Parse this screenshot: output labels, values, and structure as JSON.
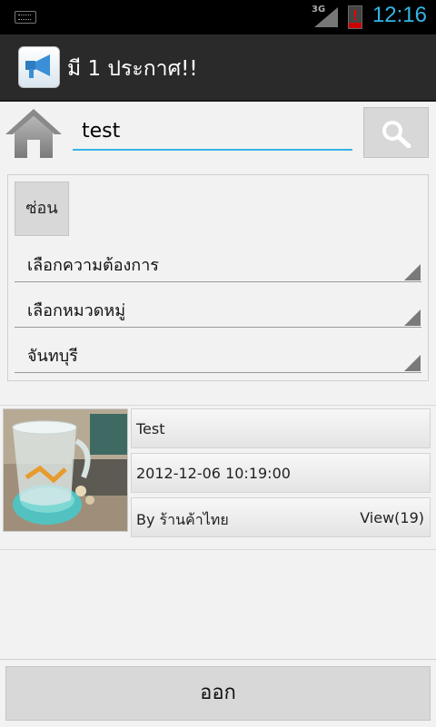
{
  "status_bar": {
    "network": "3G",
    "time": "12:16"
  },
  "title_bar": {
    "title": "มี 1 ประกาศ!!",
    "icon": "megaphone-icon"
  },
  "search": {
    "value": "test",
    "home_icon": "home-icon",
    "search_icon": "search-icon"
  },
  "filters": {
    "hide_label": "ซ่อน",
    "requirement": "เลือกความต้องการ",
    "category": "เลือกหมวดหมู่",
    "province": "จันทบุรี"
  },
  "result": {
    "title": "Test",
    "datetime": "2012-12-06 10:19:00",
    "author": "By ร้านค้าไทย",
    "views": "View(19)"
  },
  "footer": {
    "exit_label": "ออก"
  },
  "colors": {
    "accent": "#33b5e5",
    "titlebar": "#2a2a2a",
    "background": "#f2f2f2"
  }
}
